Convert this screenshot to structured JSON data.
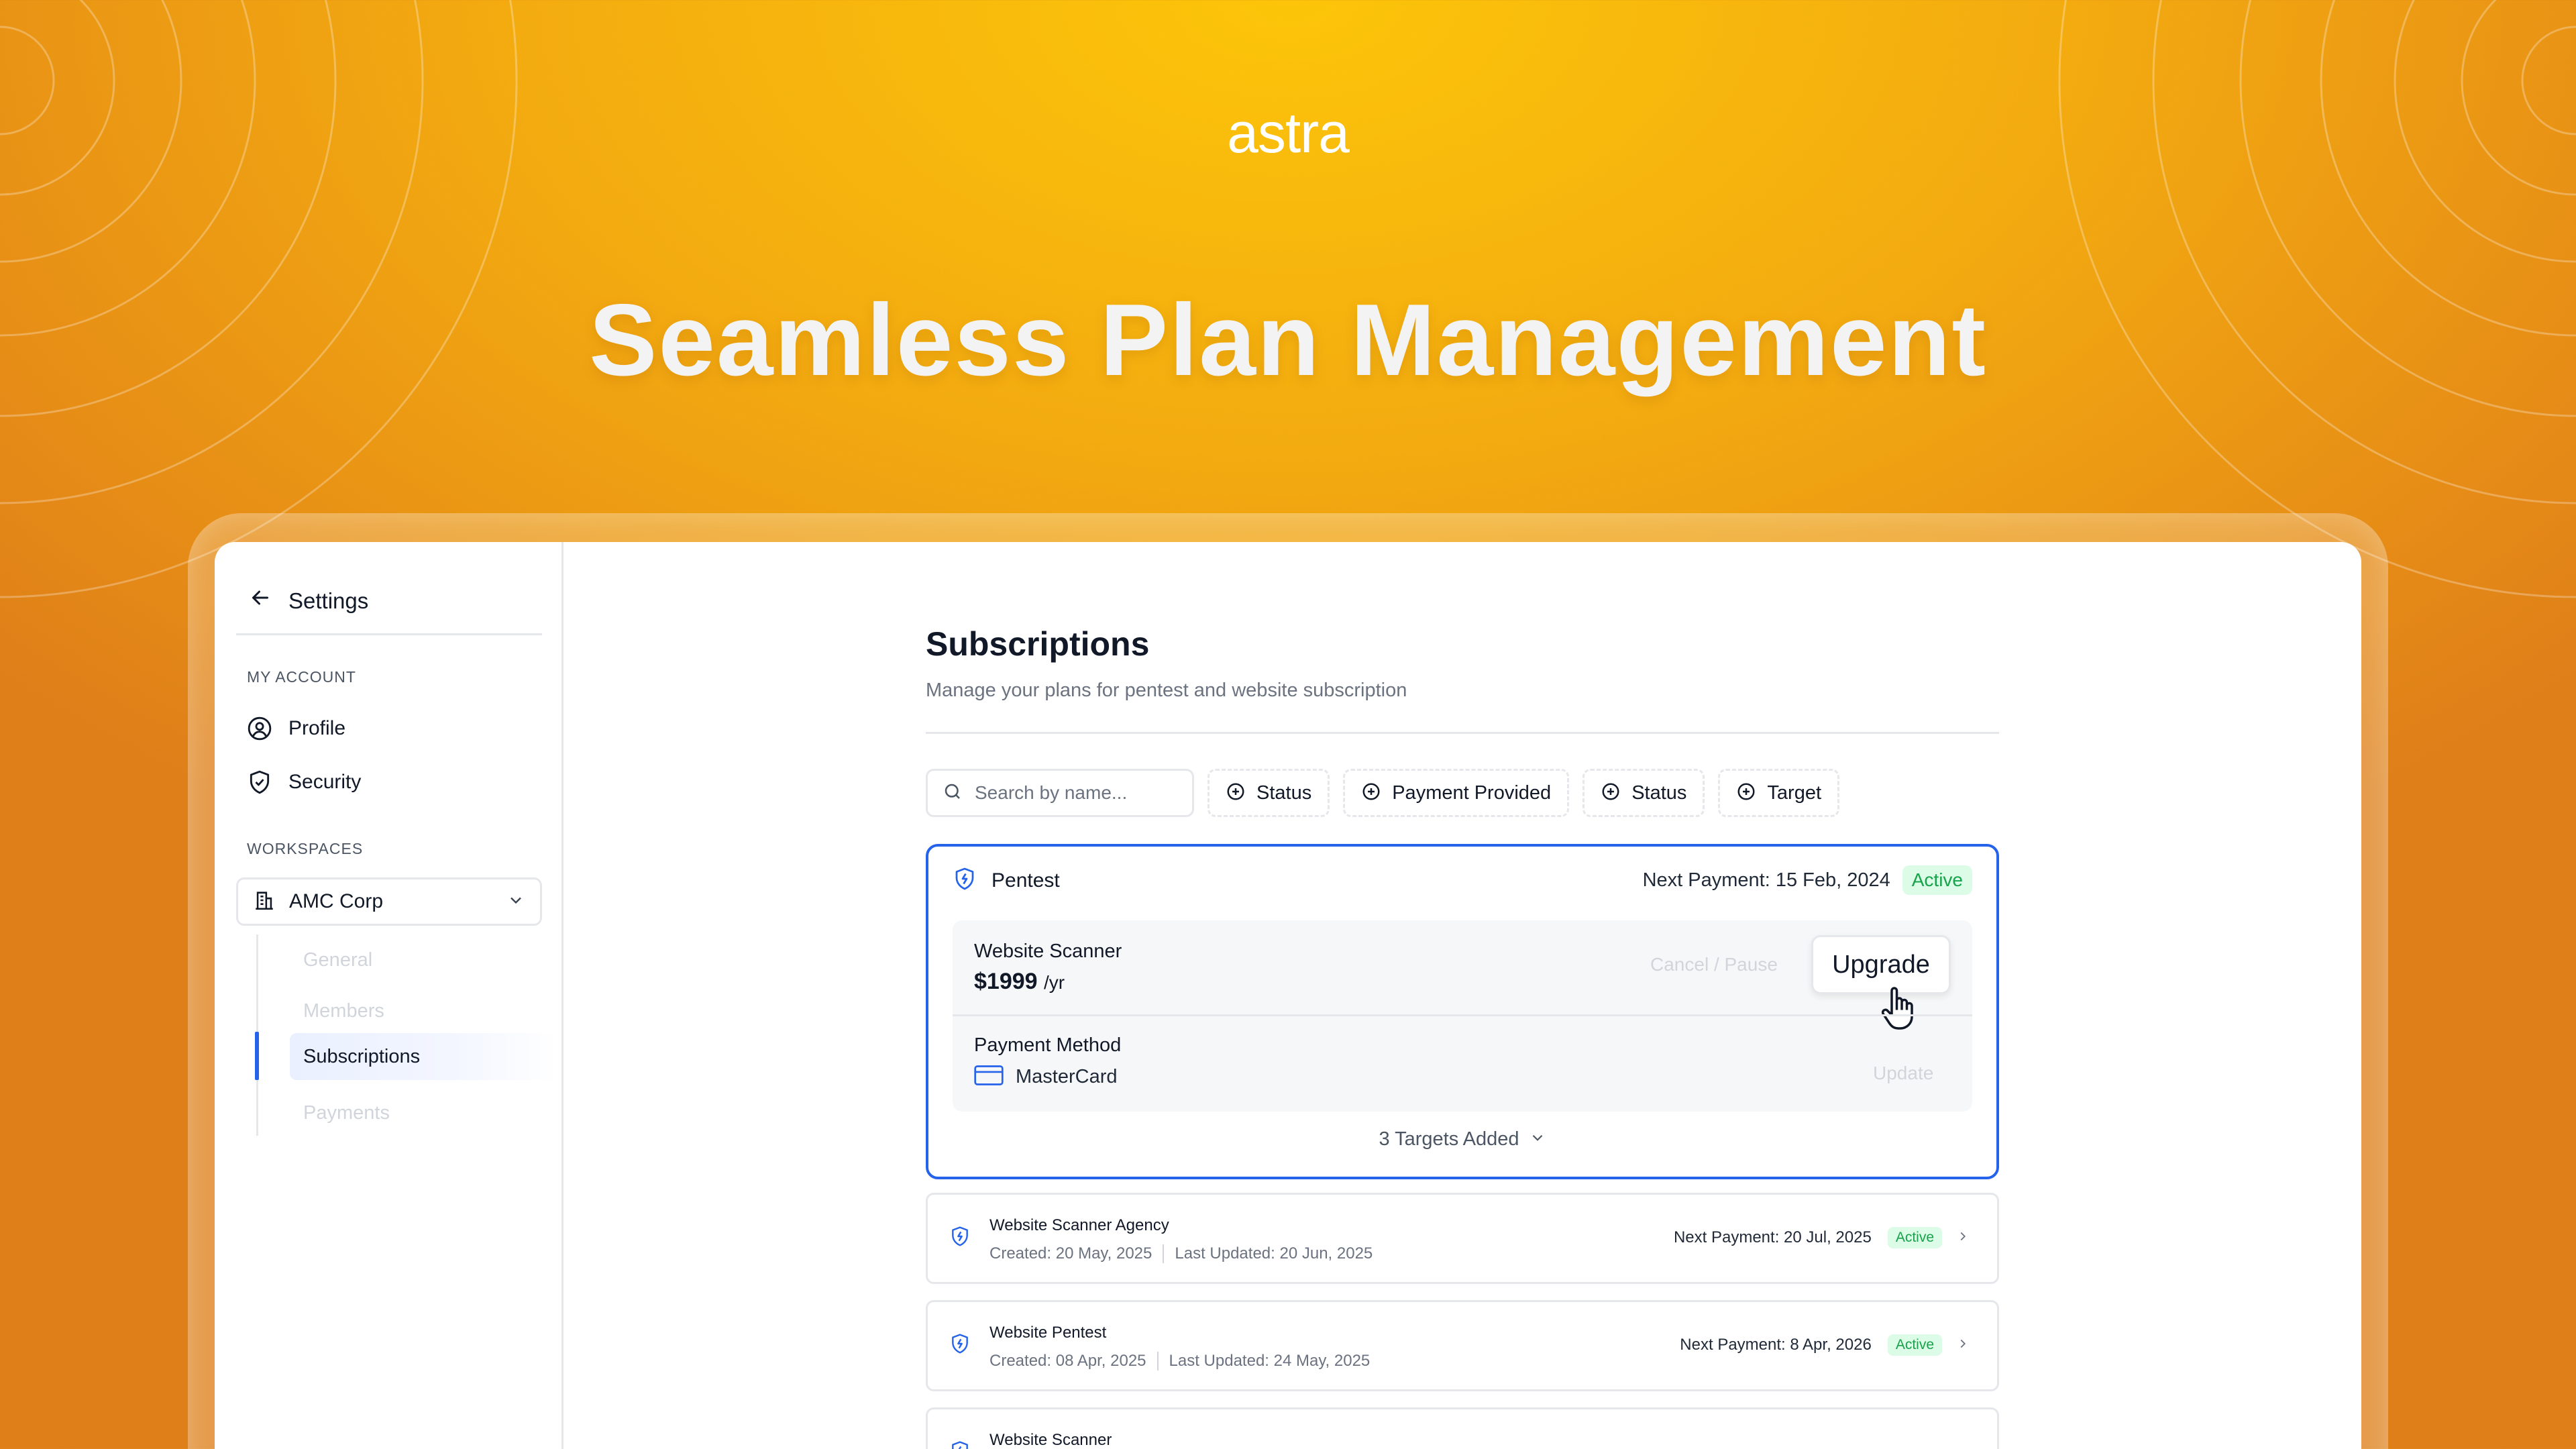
{
  "brand": {
    "logo_text": "astra"
  },
  "hero": {
    "title": "Seamless Plan Management"
  },
  "sidebar": {
    "title": "Settings",
    "sections": {
      "my_account": "MY ACCOUNT",
      "workspaces": "WORKSPACES"
    },
    "account_items": [
      {
        "label": "Profile",
        "icon": "user-circle-icon"
      },
      {
        "label": "Security",
        "icon": "shield-check-icon"
      }
    ],
    "workspace": {
      "selected": "AMC Corp",
      "icon": "building-icon"
    },
    "workspace_items": [
      {
        "label": "General",
        "active": false
      },
      {
        "label": "Members",
        "active": false
      },
      {
        "label": "Subscriptions",
        "active": true
      },
      {
        "label": "Payments",
        "active": false
      }
    ]
  },
  "main": {
    "title": "Subscriptions",
    "subtitle": "Manage your plans for pentest and website subscription",
    "search": {
      "placeholder": "Search by name..."
    },
    "filters": [
      "Status",
      "Payment Provided",
      "Status",
      "Target"
    ],
    "active_subscription": {
      "name": "Pentest",
      "next_payment": "Next Payment: 15 Feb, 2024",
      "status": "Active",
      "plan_name": "Website Scanner",
      "price": "$1999",
      "period": "/yr",
      "cancel_label": "Cancel / Pause",
      "upgrade_label": "Upgrade",
      "payment_method_label": "Payment Method",
      "payment_method": "MasterCard",
      "update_label": "Update",
      "targets_label": "3 Targets Added"
    },
    "subscriptions": [
      {
        "name": "Website Scanner Agency",
        "created": "Created: 20 May, 2025",
        "updated": "Last Updated: 20 Jun, 2025",
        "next_payment": "Next Payment: 20 Jul, 2025",
        "status": "Active"
      },
      {
        "name": "Website Pentest",
        "created": "Created: 08 Apr, 2025",
        "updated": "Last Updated: 24 May, 2025",
        "next_payment": "Next Payment: 8 Apr, 2026",
        "status": "Active"
      },
      {
        "name": "Website Scanner",
        "created": "",
        "updated": "",
        "next_payment": "",
        "status": ""
      }
    ]
  },
  "colors": {
    "accent": "#2563EB",
    "active_badge_bg": "#DCFCE7",
    "active_badge_text": "#16A34A",
    "background_top": "#FCC509",
    "background_bottom": "#DE7F19"
  }
}
